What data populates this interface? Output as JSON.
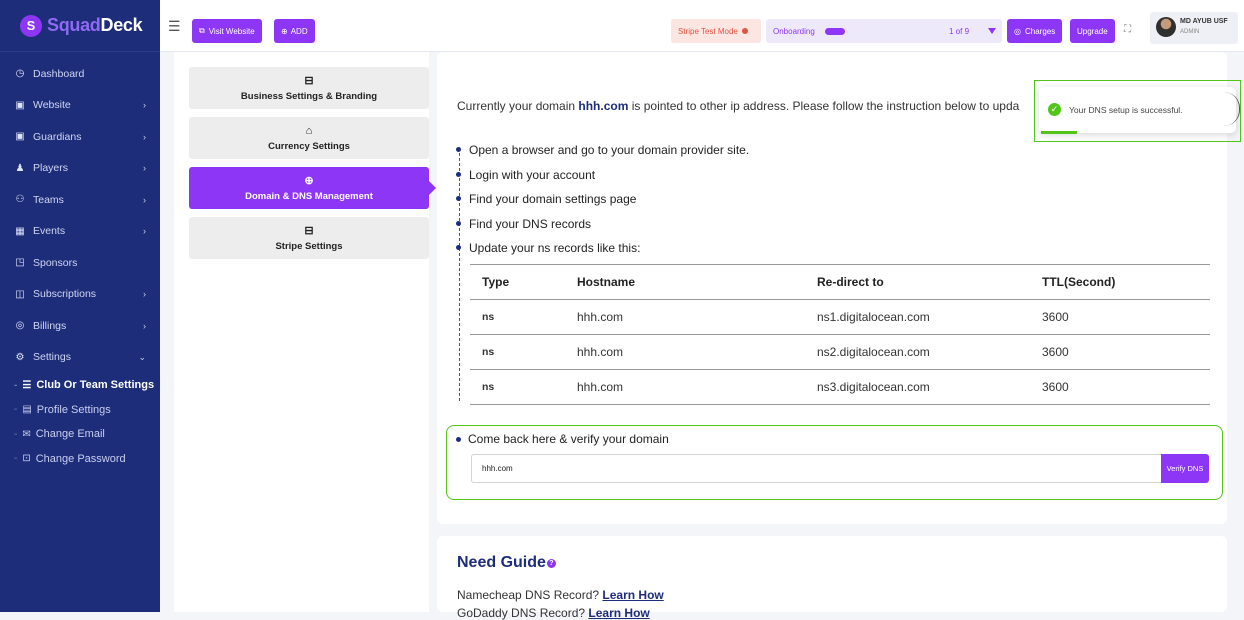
{
  "brand": {
    "part1": "Squad",
    "part2": "Deck",
    "mark": "S"
  },
  "topbar": {
    "visit_website": "Visit Website",
    "add": "ADD",
    "stripe_mode": "Stripe Test Mode",
    "onboarding": "Onboarding",
    "onboarding_step": "1 of 9",
    "onboarding_progress": 0.11,
    "charges": "Charges",
    "upgrade": "Upgrade",
    "user_name": "MD AYUB USF",
    "user_role": "ADMIN"
  },
  "sidebar": {
    "items": [
      {
        "label": "Dashboard",
        "icon": "dashboard-icon",
        "glyph": "◷",
        "chevron": ""
      },
      {
        "label": "Website",
        "icon": "website-icon",
        "glyph": "▣",
        "chevron": "›"
      },
      {
        "label": "Guardians",
        "icon": "guardians-icon",
        "glyph": "▣",
        "chevron": "›"
      },
      {
        "label": "Players",
        "icon": "players-icon",
        "glyph": "♟",
        "chevron": "›"
      },
      {
        "label": "Teams",
        "icon": "teams-icon",
        "glyph": "⚇",
        "chevron": "›"
      },
      {
        "label": "Events",
        "icon": "events-icon",
        "glyph": "▦",
        "chevron": "›"
      },
      {
        "label": "Sponsors",
        "icon": "sponsors-icon",
        "glyph": "◳",
        "chevron": ""
      },
      {
        "label": "Subscriptions",
        "icon": "subscriptions-icon",
        "glyph": "◫",
        "chevron": "›"
      },
      {
        "label": "Billings",
        "icon": "billings-icon",
        "glyph": "◎",
        "chevron": "›"
      },
      {
        "label": "Settings",
        "icon": "settings-icon",
        "glyph": "⚙",
        "chevron": "⌄"
      }
    ],
    "sub_items": [
      {
        "label": "Club Or Team Settings",
        "glyph": "☰"
      },
      {
        "label": "Profile Settings",
        "glyph": "▤"
      },
      {
        "label": "Change Email",
        "glyph": "✉"
      },
      {
        "label": "Change Password",
        "glyph": "⊡"
      }
    ]
  },
  "settings_menu": [
    {
      "label": "Business Settings & Branding",
      "glyph": "⊟"
    },
    {
      "label": "Currency Settings",
      "glyph": "⌂"
    },
    {
      "label": "Domain & DNS Management",
      "glyph": "⊕"
    },
    {
      "label": "Stripe Settings",
      "glyph": "⊟"
    }
  ],
  "main": {
    "intro_before": "Currently your domain ",
    "domain": "hhh.com",
    "intro_after": " is pointed to other ip address. Please follow the instruction below to upda",
    "steps": [
      "Open a browser and go to your domain provider site.",
      "Login with your account",
      "Find your domain settings page",
      "Find your DNS records",
      "Update your ns records like this:"
    ],
    "table": {
      "headers": [
        "Type",
        "Hostname",
        "Re-direct to",
        "TTL(Second)"
      ],
      "rows": [
        [
          "ns",
          "hhh.com",
          "ns1.digitalocean.com",
          "3600"
        ],
        [
          "ns",
          "hhh.com",
          "ns2.digitalocean.com",
          "3600"
        ],
        [
          "ns",
          "hhh.com",
          "ns3.digitalocean.com",
          "3600"
        ]
      ]
    },
    "verify_title": "Come back here & verify your domain",
    "verify_value": "hhh.com",
    "verify_button": "Verify DNS"
  },
  "guide": {
    "title": "Need Guide",
    "q": "?",
    "line1": "Namecheap DNS Record?",
    "line2": "GoDaddy DNS Record?",
    "link": "Learn How"
  },
  "toast": {
    "message": "Your DNS setup is successful."
  },
  "colors": {
    "sidebar": "#1d2d79",
    "accent": "#8e36f5",
    "success": "#52c41a"
  }
}
